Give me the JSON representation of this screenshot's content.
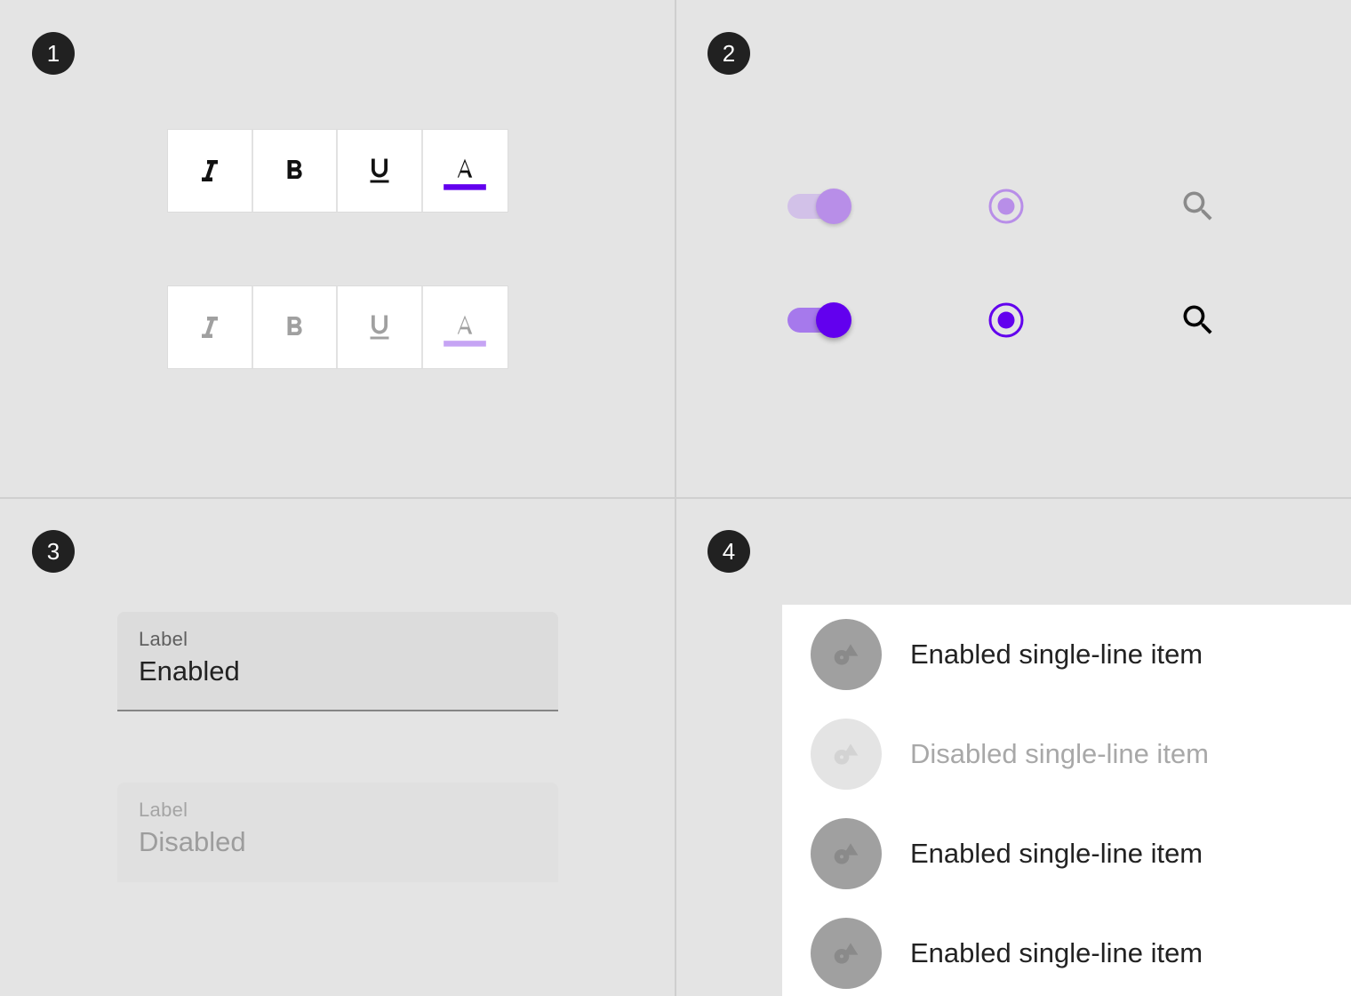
{
  "badges": {
    "one": "1",
    "two": "2",
    "three": "3",
    "four": "4"
  },
  "colors": {
    "accent": "#6200ee",
    "accent_light": "#b88ee8",
    "badge_bg": "#212121",
    "panel_bg": "#e4e4e4"
  },
  "panel1": {
    "enabled_group": [
      {
        "icon": "format-italic-icon",
        "state": "enabled"
      },
      {
        "icon": "format-bold-icon",
        "state": "enabled"
      },
      {
        "icon": "format-underline-icon",
        "state": "enabled"
      },
      {
        "icon": "format-color-text-icon",
        "state": "enabled"
      }
    ],
    "disabled_group": [
      {
        "icon": "format-italic-icon",
        "state": "disabled"
      },
      {
        "icon": "format-bold-icon",
        "state": "disabled"
      },
      {
        "icon": "format-underline-icon",
        "state": "disabled"
      },
      {
        "icon": "format-color-text-icon",
        "state": "disabled"
      }
    ]
  },
  "panel2": {
    "disabled_row": {
      "switch_on": true,
      "radio_selected": true,
      "search_icon": "search-icon",
      "state": "disabled"
    },
    "enabled_row": {
      "switch_on": true,
      "radio_selected": true,
      "search_icon": "search-icon",
      "state": "enabled"
    }
  },
  "panel3": {
    "enabled_field": {
      "label": "Label",
      "value": "Enabled"
    },
    "disabled_field": {
      "label": "Label",
      "value": "Disabled"
    }
  },
  "panel4": {
    "list_items": [
      {
        "text": "Enabled single-line item",
        "state": "enabled",
        "icon": "shapes-icon"
      },
      {
        "text": "Disabled single-line item",
        "state": "disabled",
        "icon": "shapes-icon"
      },
      {
        "text": "Enabled single-line item",
        "state": "enabled",
        "icon": "shapes-icon"
      },
      {
        "text": "Enabled single-line item",
        "state": "enabled",
        "icon": "shapes-icon"
      }
    ]
  }
}
